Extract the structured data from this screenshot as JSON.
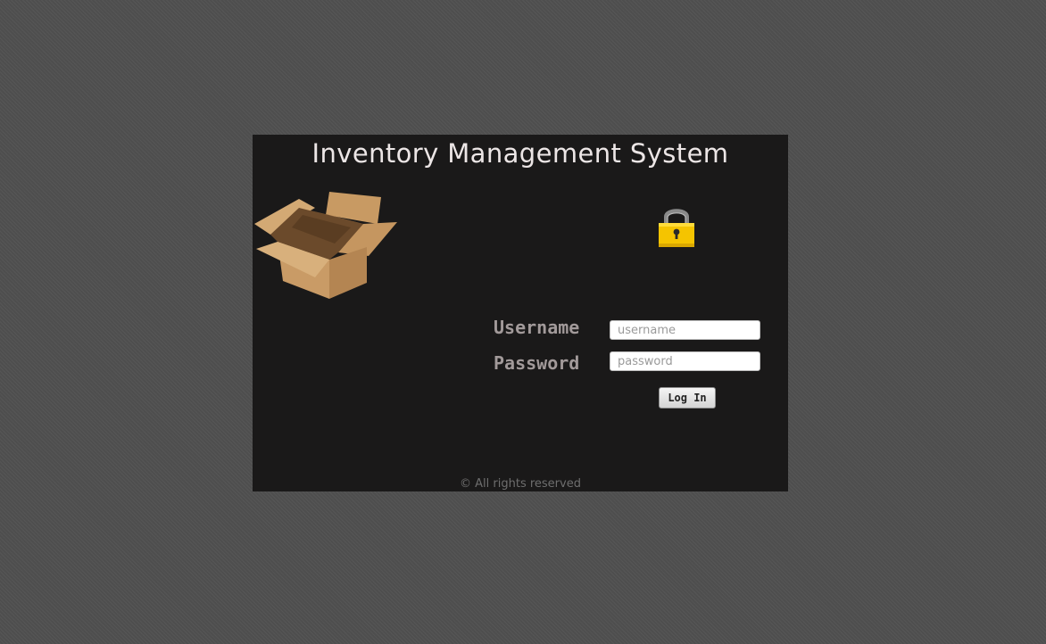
{
  "page": {
    "title": "Inventory Management System",
    "footer": "© All rights reserved"
  },
  "images": {
    "box": "cardboard-box",
    "lock": "padlock-icon"
  },
  "form": {
    "username_label": "Username",
    "username_placeholder": "username",
    "username_value": "",
    "password_label": "Password",
    "password_placeholder": "password",
    "password_value": "",
    "submit_label": "Log In"
  },
  "colors": {
    "background": "#515151",
    "panel": "#1a1919",
    "title": "#ece6e6",
    "label": "#a29a9a",
    "lock_body": "#f5c400"
  }
}
